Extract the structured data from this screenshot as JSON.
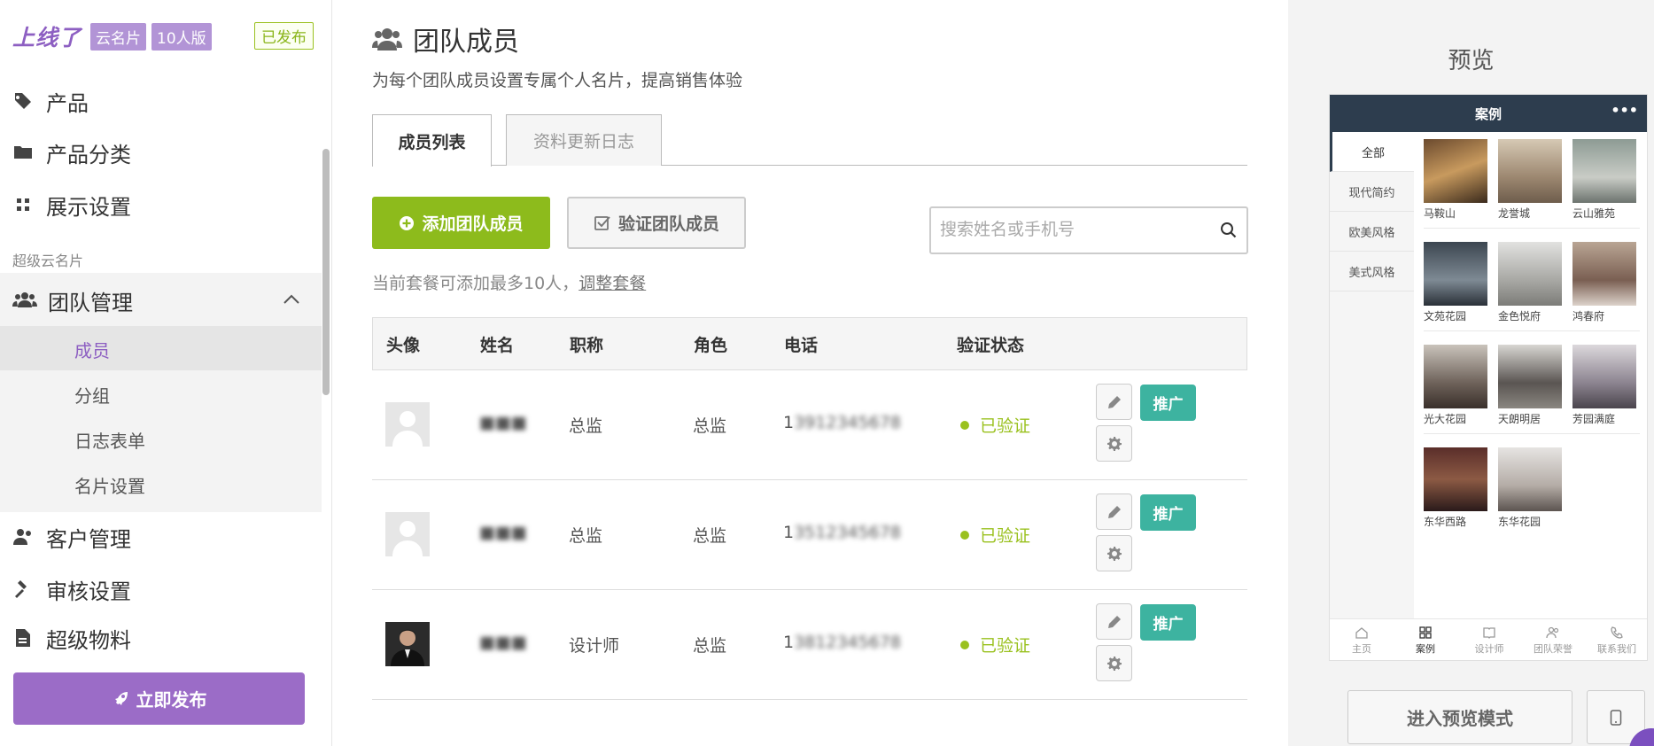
{
  "brand": {
    "logo": "上线了",
    "tag1": "云名片",
    "tag2": "10人版",
    "status": "已发布"
  },
  "sidebar": {
    "items": [
      {
        "label": "产品"
      },
      {
        "label": "产品分类"
      },
      {
        "label": "展示设置"
      }
    ],
    "section_label": "超级云名片",
    "team": {
      "label": "团队管理",
      "subitems": [
        {
          "label": "成员"
        },
        {
          "label": "分组"
        },
        {
          "label": "日志表单"
        },
        {
          "label": "名片设置"
        }
      ]
    },
    "bottom_items": [
      {
        "label": "客户管理"
      },
      {
        "label": "审核设置"
      },
      {
        "label": "超级物料"
      }
    ],
    "publish_label": "立即发布"
  },
  "main": {
    "title": "团队成员",
    "subtitle": "为每个团队成员设置专属个人名片，提高销售体验",
    "tabs": [
      {
        "label": "成员列表"
      },
      {
        "label": "资料更新日志"
      }
    ],
    "add_label": "添加团队成员",
    "verify_label": "验证团队成员",
    "search_placeholder": "搜索姓名或手机号",
    "quota_text": "当前套餐可添加最多10人，",
    "quota_link": "调整套餐",
    "columns": [
      "头像",
      "姓名",
      "职称",
      "角色",
      "电话",
      "验证状态"
    ],
    "rows": [
      {
        "name": "■■■",
        "title": "总监",
        "role": "总监",
        "phone_prefix": "1",
        "phone_hidden": "3912345678",
        "status": "已验证",
        "promote": "推广"
      },
      {
        "name": "■■■",
        "title": "总监",
        "role": "总监",
        "phone_prefix": "1",
        "phone_hidden": "3512345678",
        "status": "已验证",
        "promote": "推广"
      },
      {
        "name": "■■■",
        "title": "设计师",
        "role": "总监",
        "phone_prefix": "1",
        "phone_hidden": "3812345678",
        "status": "已验证",
        "promote": "推广"
      }
    ]
  },
  "preview": {
    "title": "预览",
    "phone_header": "案例",
    "categories": [
      "全部",
      "现代简约",
      "欧美风格",
      "美式风格"
    ],
    "cases": [
      "马鞍山",
      "龙誉城",
      "云山雅苑",
      "文苑花园",
      "金色悦府",
      "鸿春府",
      "光大花园",
      "天朗明居",
      "芳园满庭",
      "东华西路",
      "东华花园"
    ],
    "bottom_nav": [
      "主页",
      "案例",
      "设计师",
      "团队荣誉",
      "联系我们"
    ],
    "enter_label": "进入预览模式"
  },
  "colors": {
    "accent": "#9b6cc7",
    "green": "#8dbb1c",
    "teal": "#3db3a0",
    "status": "#9ac11f"
  }
}
